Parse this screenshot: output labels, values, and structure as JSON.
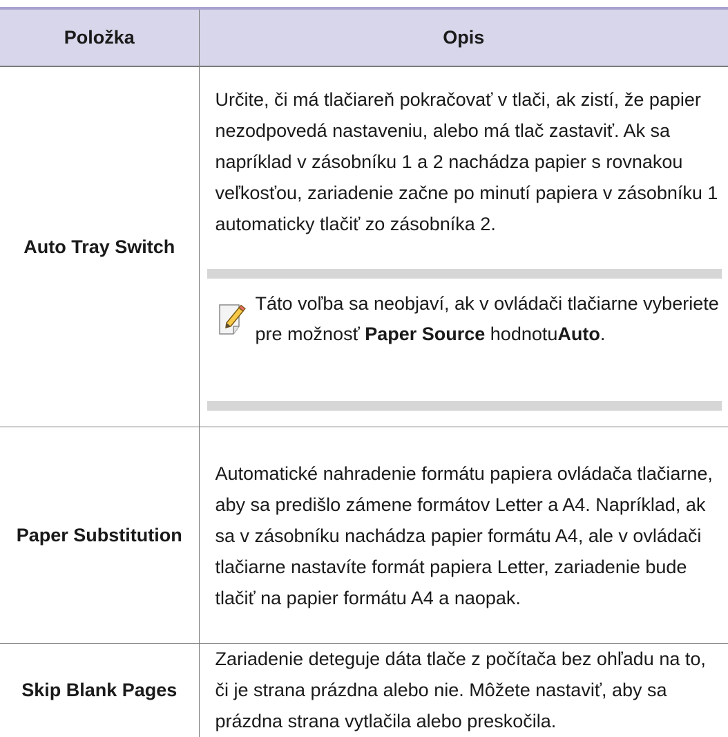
{
  "table": {
    "headers": {
      "item": "Položka",
      "description": "Opis"
    },
    "rows": [
      {
        "item": "Auto Tray Switch",
        "description": "Určite, či má tlačiareň pokračovať v tlači, ak zistí, že papier nezodpovedá nastaveniu, alebo má tlač zastaviť. Ak sa napríklad v zásobníku 1 a 2 nachádza papier s rovnakou veľkosťou, zariadenie začne po minutí papiera v zásobníku 1 automaticky tlačiť zo zásobníka 2.",
        "note": {
          "text_before": "Táto voľba sa neobjaví, ak v ovládači tlačiarne vyberiete pre možnosť ",
          "bold_1": "Paper Source",
          "text_middle": " hodnotu",
          "bold_2": "Auto",
          "text_after": "."
        }
      },
      {
        "item": "Paper Substitution",
        "description": "Automatické nahradenie formátu papiera ovládača tlačiarne, aby sa predišlo zámene formátov Letter a A4. Napríklad, ak sa v zásobníku nachádza papier formátu A4, ale v ovládači tlačiarne nastavíte formát papiera Letter, zariadenie bude tlačiť na papier formátu A4 a naopak."
      },
      {
        "item": "Skip Blank Pages",
        "description": "Zariadenie deteguje dáta tlače z počítača bez ohľadu na to, či je strana prázdna alebo nie. Môžete nastaviť, aby sa prázdna strana vytlačila alebo preskočila."
      }
    ]
  },
  "icons": {
    "note": "note-pencil-icon"
  },
  "colors": {
    "header_bg": "#d7d6ea",
    "top_rule": "#a9a3cf",
    "note_bar": "#d6d6d6"
  }
}
